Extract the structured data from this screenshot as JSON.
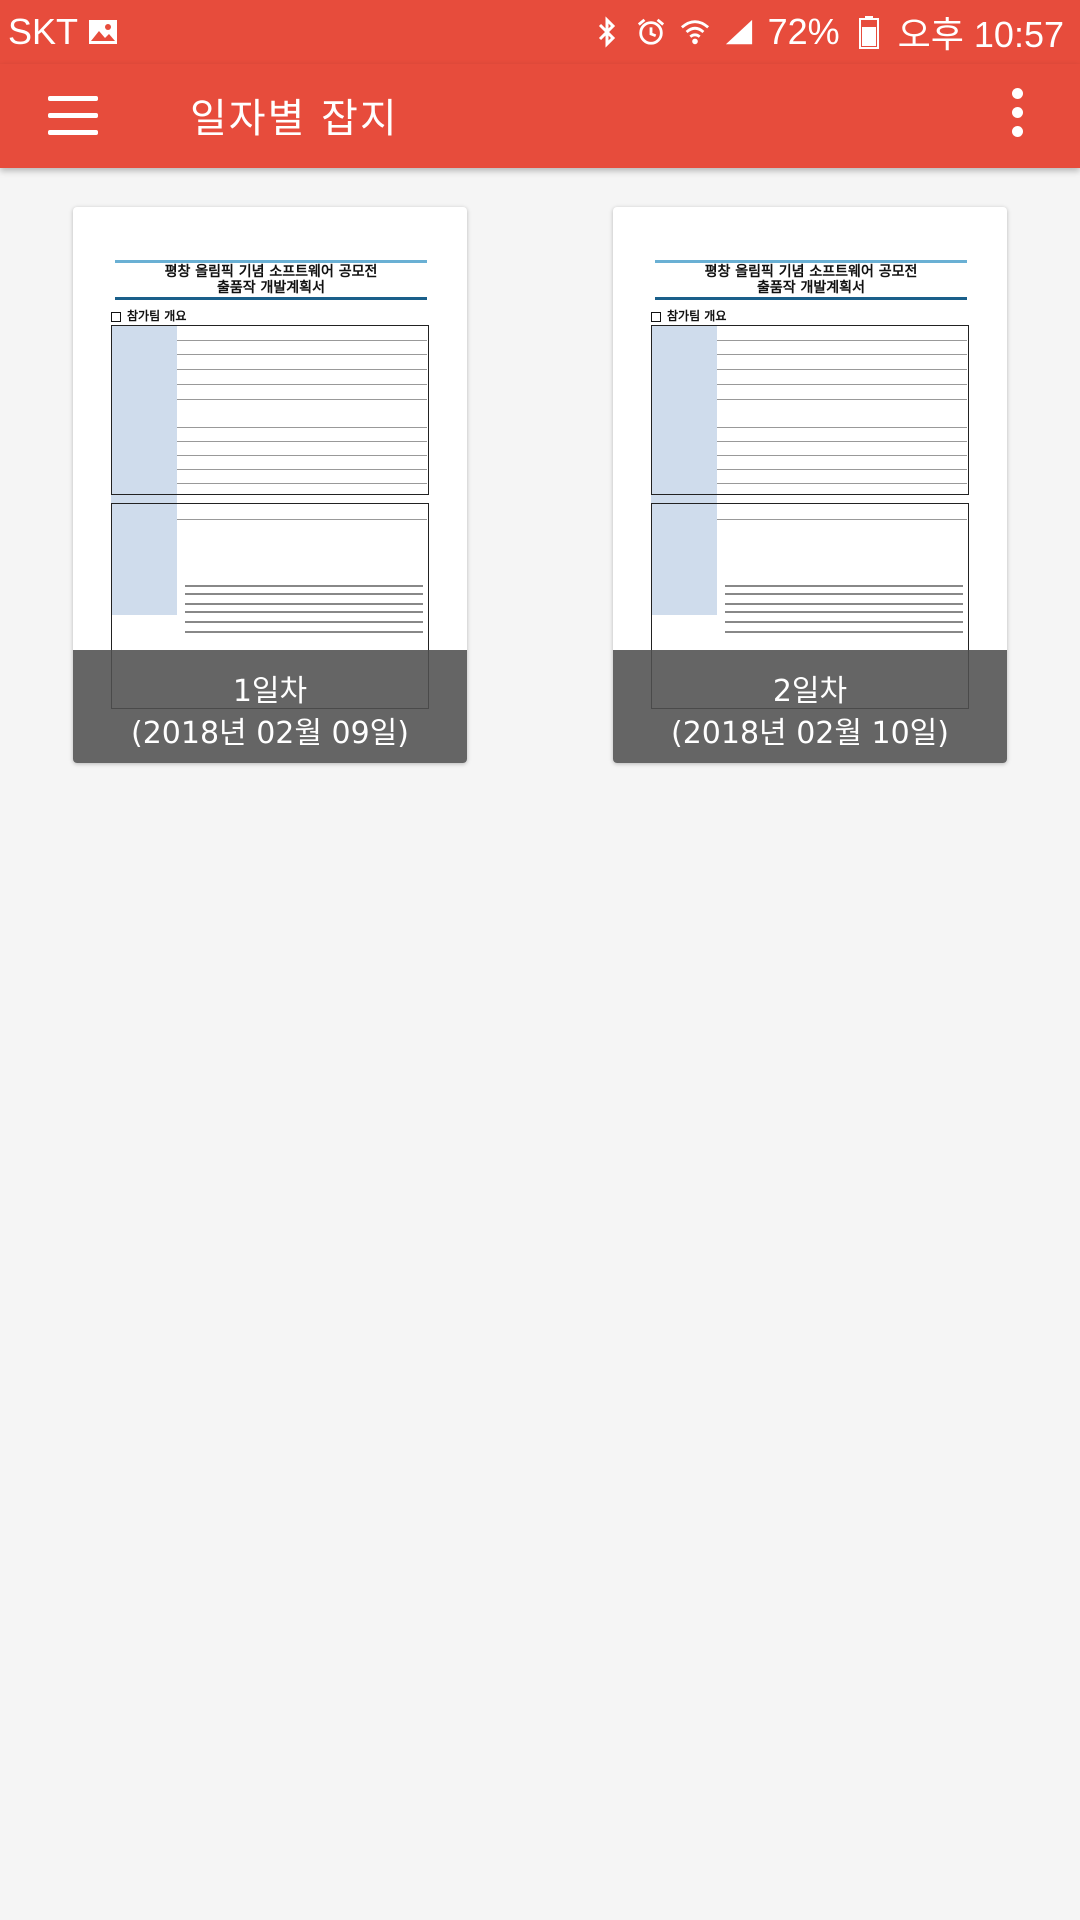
{
  "status_bar": {
    "carrier": "SKT",
    "battery": "72%",
    "time": "오후 10:57",
    "icons": [
      "image-icon",
      "bluetooth-icon",
      "alarm-icon",
      "wifi-icon",
      "signal-icon",
      "battery-icon"
    ]
  },
  "app_bar": {
    "title": "일자별 잡지",
    "accent_color": "#e74c3c"
  },
  "cards": [
    {
      "day": "1일차",
      "date": "(2018년 02월 09일)"
    },
    {
      "day": "2일차",
      "date": "(2018년 02월 10일)"
    }
  ],
  "document_thumbnail": {
    "title_line1": "평창 올림픽 기념 소프트웨어 공모전",
    "title_line2": "출품작 개발계획서",
    "section": "참가팀 개요"
  }
}
